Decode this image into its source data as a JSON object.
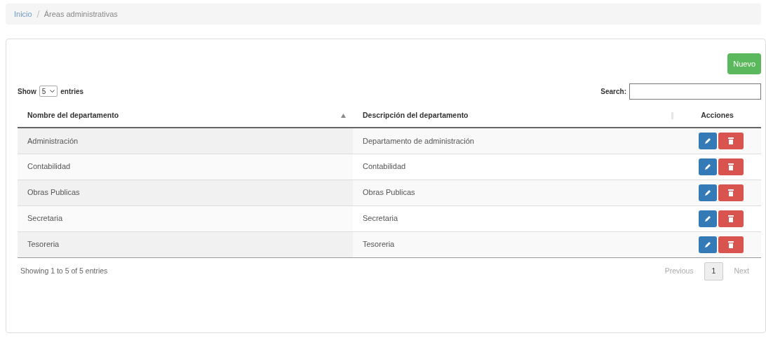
{
  "breadcrumb": [
    {
      "label": "Inicio",
      "kind": "link"
    },
    {
      "label": "Áreas administrativas",
      "kind": "current"
    }
  ],
  "new_button": "Nuevo",
  "length": {
    "before": "Show",
    "value": "5",
    "after": "entries"
  },
  "search": {
    "label": "Search:"
  },
  "table": {
    "columns": [
      {
        "label": "Nombre del departamento",
        "sortable": true,
        "sorted": true
      },
      {
        "label": "Descripción del departamento",
        "sortable": true,
        "sorted": false
      },
      {
        "label": "Acciones"
      }
    ],
    "rows": [
      [
        "Administración",
        "Departamento de administración"
      ],
      [
        "Contabilidad",
        "Contabilidad"
      ],
      [
        "Obras Publicas",
        "Obras Publicas"
      ],
      [
        "Secretaria",
        "Secretaria"
      ],
      [
        "Tesoreria",
        "Tesoreria"
      ]
    ]
  },
  "info": "Showing 1 to 5 of 5 entries",
  "pagination": [
    {
      "label": "Previous",
      "disabled": true,
      "selected": false
    },
    {
      "label": "1",
      "disabled": false,
      "selected": true
    },
    {
      "label": "Next",
      "disabled": true,
      "selected": false
    }
  ]
}
